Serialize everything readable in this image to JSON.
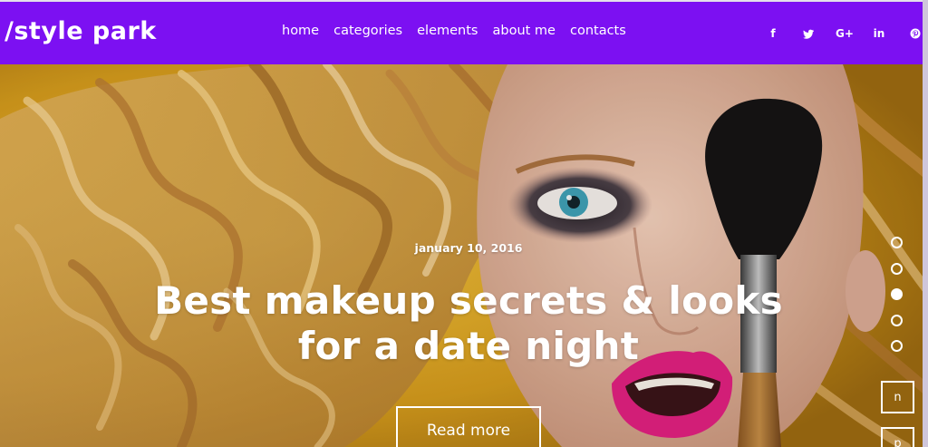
{
  "header": {
    "logo": "/style park",
    "nav": [
      "home",
      "categories",
      "elements",
      "about me",
      "contacts"
    ],
    "social": [
      {
        "icon": "facebook-icon",
        "glyph": "f"
      },
      {
        "icon": "twitter-icon",
        "glyph": "🐦"
      },
      {
        "icon": "google-plus-icon",
        "glyph": "G+"
      },
      {
        "icon": "linkedin-icon",
        "glyph": "in"
      },
      {
        "icon": "pinterest-icon",
        "glyph": "℗"
      }
    ]
  },
  "hero": {
    "date": "january 10, 2016",
    "title": "Best makeup secrets & looks for a date night",
    "button_label": "Read more",
    "slider": {
      "count": 5,
      "active": 3
    },
    "nav_next": "n",
    "nav_prev": "p"
  },
  "colors": {
    "header_bg": "#7c10f2",
    "hero_bg": "#d9a423",
    "lip": "#e0207f"
  }
}
